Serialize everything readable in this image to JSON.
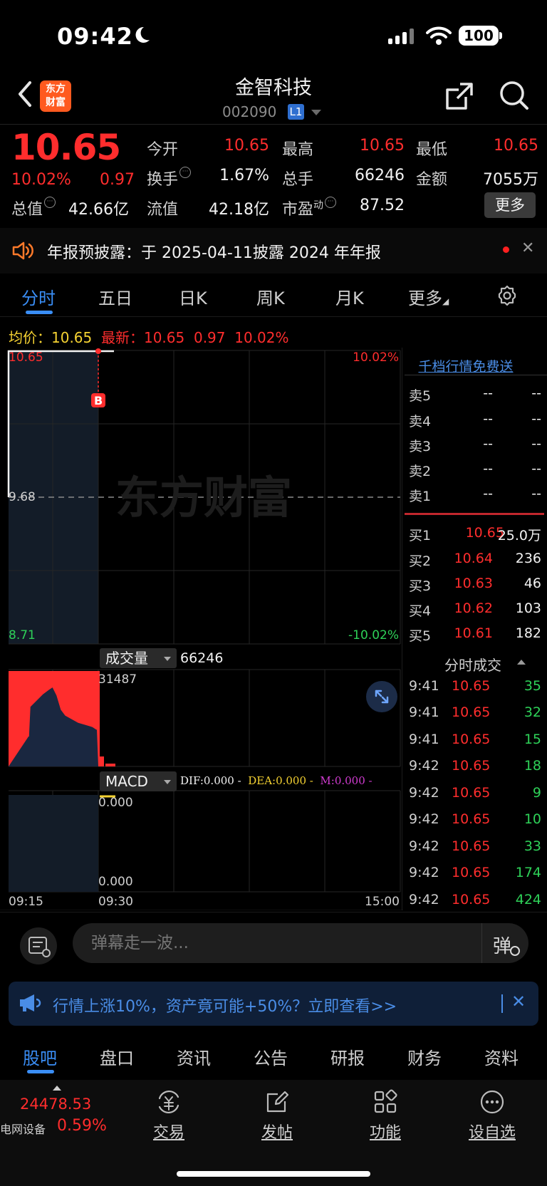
{
  "status": {
    "time": "09:42",
    "battery": "100"
  },
  "header": {
    "title": "金智科技",
    "code": "002090",
    "level": "L1",
    "logo_line1": "东方",
    "logo_line2": "财富"
  },
  "quote": {
    "price": "10.65",
    "pct": "10.02%",
    "chg": "0.97",
    "open_label": "今开",
    "open": "10.65",
    "high_label": "最高",
    "high": "10.65",
    "low_label": "最低",
    "low": "10.65",
    "turnover_label": "换手",
    "turnover": "1.67%",
    "volume_label": "总手",
    "volume": "66246",
    "amount_label": "金额",
    "amount": "7055万",
    "mcap_label": "总值",
    "mcap": "42.66亿",
    "float_label": "流值",
    "float": "42.18亿",
    "pe_label": "市盈",
    "pe_sup": "动",
    "pe": "87.52",
    "more": "更多"
  },
  "notice": {
    "text": "年报预披露：于 2025-04-11披露 2024 年年报",
    "close": "✕"
  },
  "chart_tabs": [
    "分时",
    "五日",
    "日K",
    "周K",
    "月K",
    "更多"
  ],
  "avg_line": {
    "avg_label": "均价：",
    "avg": "10.65",
    "latest_label": "最新：",
    "latest": "10.65",
    "chg": "0.97",
    "pct": "10.02%"
  },
  "chart": {
    "y_top": "10.65",
    "y_mid": "9.68",
    "y_bot": "8.71",
    "pct_top": "10.02%",
    "pct_bot": "-10.02%",
    "watermark": "东方财富",
    "marker": "B",
    "vol_label": "成交量",
    "vol_total": "66246",
    "vol_max": "31487",
    "macd_label": "MACD",
    "dif": "DIF:0.000 -",
    "dea": "DEA:0.000 -",
    "m": "M:0.000 -",
    "macd_top": "0.000",
    "macd_bot": "0.000",
    "t_start": "09:15",
    "t_mid": "09:30",
    "t_end": "15:00",
    "colors": {
      "up": "#ff2d2d",
      "down": "#2ed158",
      "avg": "#f5d232",
      "dea": "#f5d232",
      "m": "#d23cd2"
    }
  },
  "orderbook": {
    "vip": "千档行情免费送",
    "asks": [
      {
        "label": "卖5",
        "price": "--",
        "vol": "--"
      },
      {
        "label": "卖4",
        "price": "--",
        "vol": "--"
      },
      {
        "label": "卖3",
        "price": "--",
        "vol": "--"
      },
      {
        "label": "卖2",
        "price": "--",
        "vol": "--"
      },
      {
        "label": "卖1",
        "price": "--",
        "vol": "--"
      }
    ],
    "bids": [
      {
        "label": "买1",
        "price": "10.65",
        "vol": "25.0万"
      },
      {
        "label": "买2",
        "price": "10.64",
        "vol": "236"
      },
      {
        "label": "买3",
        "price": "10.63",
        "vol": "46"
      },
      {
        "label": "买4",
        "price": "10.62",
        "vol": "103"
      },
      {
        "label": "买5",
        "price": "10.61",
        "vol": "182"
      }
    ]
  },
  "trades": {
    "title": "分时成交",
    "rows": [
      {
        "time": "9:41",
        "price": "10.65",
        "vol": "35"
      },
      {
        "time": "9:41",
        "price": "10.65",
        "vol": "32"
      },
      {
        "time": "9:41",
        "price": "10.65",
        "vol": "15"
      },
      {
        "time": "9:42",
        "price": "10.65",
        "vol": "18"
      },
      {
        "time": "9:42",
        "price": "10.65",
        "vol": "9"
      },
      {
        "time": "9:42",
        "price": "10.65",
        "vol": "10"
      },
      {
        "time": "9:42",
        "price": "10.65",
        "vol": "33"
      },
      {
        "time": "9:42",
        "price": "10.65",
        "vol": "174"
      },
      {
        "time": "9:42",
        "price": "10.65",
        "vol": "424"
      }
    ]
  },
  "comment": {
    "placeholder": "弹幕走一波...",
    "danmu": "弹"
  },
  "promo": {
    "text": "行情上涨10%，资产竟可能+50%？立即查看>>",
    "close": "✕"
  },
  "bottom_tabs": [
    "股吧",
    "盘口",
    "资讯",
    "公告",
    "研报",
    "财务",
    "资料"
  ],
  "bottom_bar": {
    "index_value": "24478.53",
    "index_name": "电网设备",
    "index_pct": "0.59%",
    "nav": [
      "交易",
      "发帖",
      "功能",
      "设自选"
    ]
  }
}
